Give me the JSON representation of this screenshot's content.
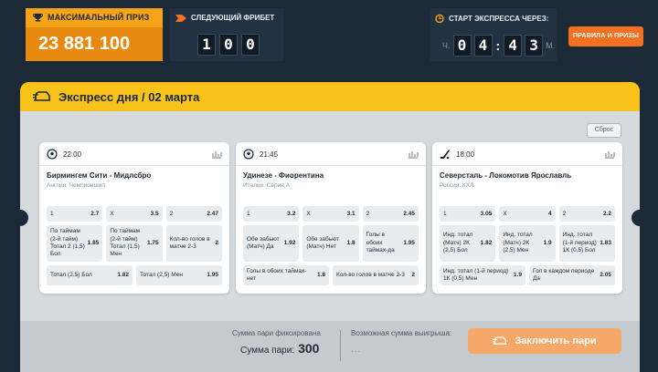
{
  "header": {
    "prize_label": "МАКСИМАЛЬНЫЙ ПРИЗ",
    "prize_value": "23 881 100",
    "freebet_label": "СЛЕДУЮЩИЙ ФРИБЕТ",
    "freebet_digits": [
      "1",
      "0",
      "0"
    ],
    "timer_label": "СТАРТ ЭКСПРЕССА ЧЕРЕЗ:",
    "timer_hours_unit": "Ч.",
    "timer_digits": [
      "0",
      "4",
      "4",
      "3"
    ],
    "timer_minutes_unit": "М.",
    "rules_button": "ПРАВИЛА И ПРИЗЫ",
    "accent_color": "#f5a31a"
  },
  "panel": {
    "title": "Экспресс дня / 02 марта",
    "reset_button": "Сброс"
  },
  "cards": [
    {
      "sport_icon": "soccer-ball-icon",
      "time": "22:00",
      "match": "Бирмингем Сити - Мидлсбро",
      "league": "Англия. Чемпионшип",
      "rows": [
        [
          {
            "label": "1",
            "odds": "2.7"
          },
          {
            "label": "X",
            "odds": "3.5"
          },
          {
            "label": "2",
            "odds": "2.47"
          }
        ],
        [
          {
            "label": "По таймам (2-й тайм) Тотал 2 (1,5) Бол",
            "odds": "1.85"
          },
          {
            "label": "По таймам (2-й тайм) Тотал (1,5) Мен",
            "odds": "1.75"
          },
          {
            "label": "Кол-во голов в матче 2-3",
            "odds": "2"
          }
        ],
        [
          {
            "label": "Тотал (2,5) Бол",
            "odds": "1.82"
          },
          {
            "label": "Тотал (2,5) Мен",
            "odds": "1.95"
          }
        ]
      ]
    },
    {
      "sport_icon": "soccer-ball-icon",
      "time": "21:45",
      "match": "Удинезе - Фиорентина",
      "league": "Италия. Серия А",
      "rows": [
        [
          {
            "label": "1",
            "odds": "3.2"
          },
          {
            "label": "X",
            "odds": "3.1"
          },
          {
            "label": "2",
            "odds": "2.45"
          }
        ],
        [
          {
            "label": "Обе забьют (Матч) Да",
            "odds": "1.92"
          },
          {
            "label": "Обе забьют (Матч) Нет",
            "odds": "1.8"
          },
          {
            "label": "Голы в обоих таймах-да",
            "odds": "1.95"
          }
        ],
        [
          {
            "label": "Голы в обоих таймах-нет",
            "odds": "1.8"
          },
          {
            "label": "Кол-во голов в матче 2-3",
            "odds": "2"
          }
        ]
      ]
    },
    {
      "sport_icon": "hockey-stick-icon",
      "time": "18:00",
      "match": "Северсталь - Локомотив Ярославль",
      "league": "Россия. КХЛ",
      "rows": [
        [
          {
            "label": "1",
            "odds": "3.05"
          },
          {
            "label": "X",
            "odds": "4"
          },
          {
            "label": "2",
            "odds": "2.2"
          }
        ],
        [
          {
            "label": "Инд. тотал (Матч) 2К (2,5) Бол",
            "odds": "1.82"
          },
          {
            "label": "Инд. тотал (Матч) 2К (2,5) Мен",
            "odds": "1.9"
          },
          {
            "label": "Инд. тотал (1-й период) 1К (0,5) Бол",
            "odds": "1.83"
          }
        ],
        [
          {
            "label": "Инд. тотал (1-й период) 1К (0,5) Мен",
            "odds": "1.9"
          },
          {
            "label": "Гол в каждом периоде Да",
            "odds": "2.05"
          }
        ]
      ]
    }
  ],
  "footer": {
    "fixed_label": "Сумма пари фиксирована",
    "stake_label": "Сумма пари:",
    "stake_value": "300",
    "win_label": "Возможная сумма выигрыша:",
    "win_value": "...",
    "bet_button": "Заключить пари"
  }
}
